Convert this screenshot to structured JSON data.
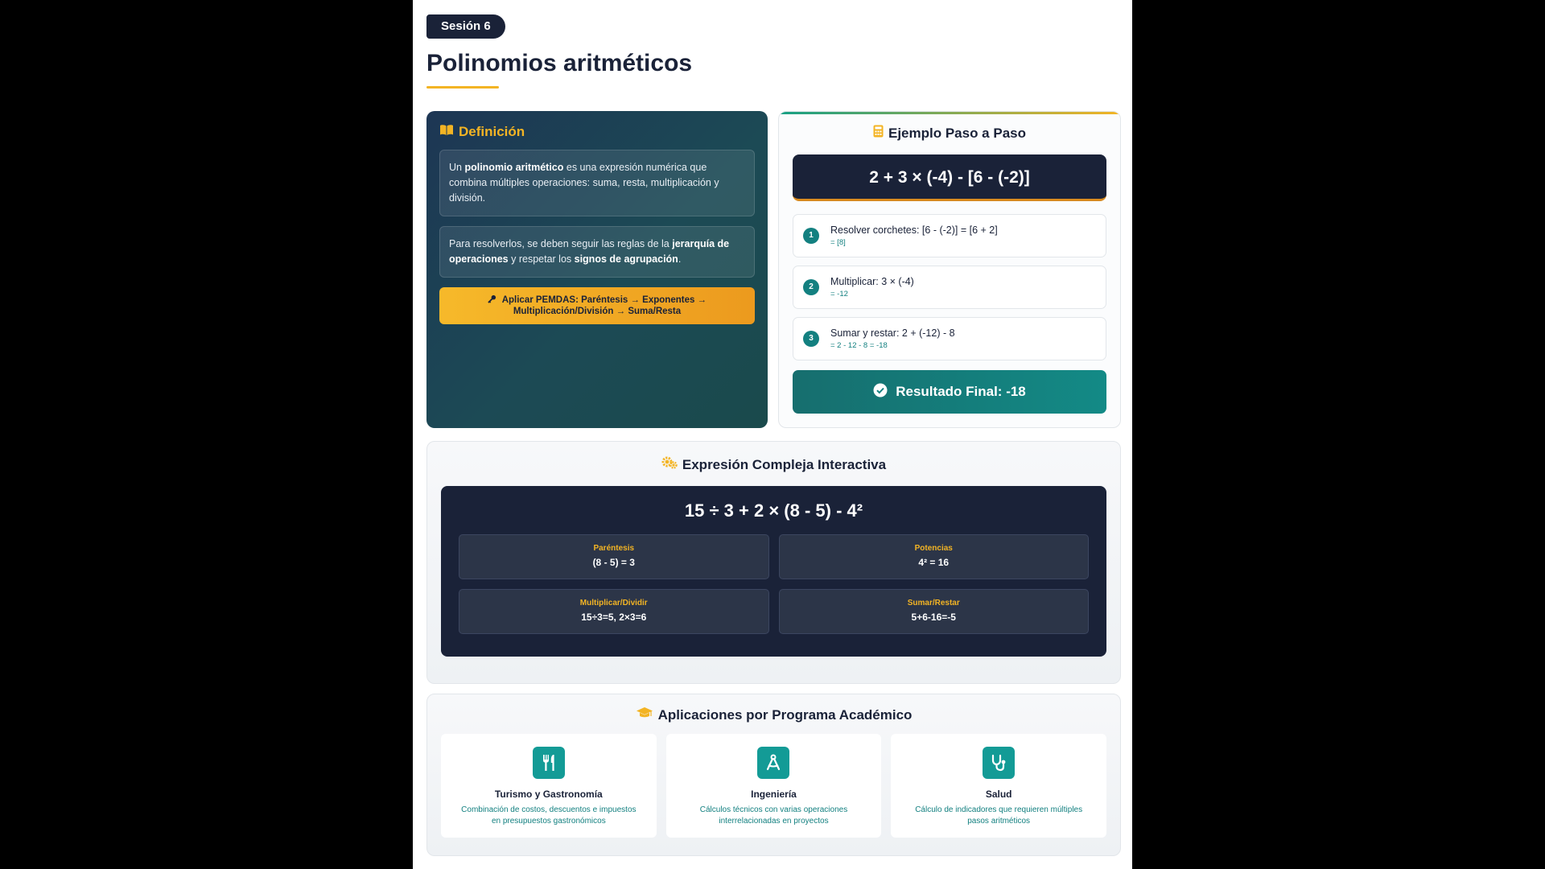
{
  "header": {
    "session_badge": "Sesión 6",
    "title": "Polinomios aritméticos"
  },
  "definition": {
    "title": "Definición",
    "p1_a": "Un ",
    "p1_bold": "polinomio aritmético",
    "p1_b": " es una expresión numérica que combina múltiples operaciones: suma, resta, multiplicación y división.",
    "p2_a": "Para resolverlos, se deben seguir las reglas de la ",
    "p2_bold1": "jerarquía de operaciones",
    "p2_b": " y respetar los ",
    "p2_bold2": "signos de agrupación",
    "p2_c": ".",
    "pemdas_line1": "Aplicar PEMDAS: Paréntesis → Exponentes →",
    "pemdas_line2": "Multiplicación/División → Suma/Resta"
  },
  "example": {
    "title": "Ejemplo Paso a Paso",
    "expression": "2 + 3 × (-4) - [6 - (-2)]",
    "steps": [
      {
        "num": "1",
        "main": "Resolver corchetes: [6 - (-2)] = [6 + 2]",
        "sub": "= [8]"
      },
      {
        "num": "2",
        "main": "Multiplicar: 3 × (-4)",
        "sub": "= -12"
      },
      {
        "num": "3",
        "main": "Sumar y restar: 2 + (-12) - 8",
        "sub": "= 2 - 12 - 8 = -18"
      }
    ],
    "result": "Resultado Final: -18"
  },
  "complex": {
    "title": "Expresión Compleja Interactiva",
    "expression": "15 ÷ 3 + 2 × (8 - 5) - 4²",
    "cells": [
      {
        "label": "Paréntesis",
        "value": "(8 - 5) = 3"
      },
      {
        "label": "Potencias",
        "value": "4² = 16"
      },
      {
        "label": "Multiplicar/Dividir",
        "value": "15÷3=5, 2×3=6"
      },
      {
        "label": "Sumar/Restar",
        "value": "5+6-16=-5"
      }
    ]
  },
  "applications": {
    "title": "Aplicaciones por Programa Académico",
    "items": [
      {
        "name": "Turismo y Gastronomía",
        "desc": "Combinación de costos, descuentos e impuestos en presupuestos gastronómicos",
        "icon": "utensils-icon"
      },
      {
        "name": "Ingeniería",
        "desc": "Cálculos técnicos con varias operaciones interrelacionadas en proyectos",
        "icon": "compass-icon"
      },
      {
        "name": "Salud",
        "desc": "Cálculo de indicadores que requieren múltiples pasos aritméticos",
        "icon": "stethoscope-icon"
      }
    ]
  },
  "colors": {
    "navy": "#1a2238",
    "accent_gold": "#f3b424",
    "teal": "#138080"
  }
}
